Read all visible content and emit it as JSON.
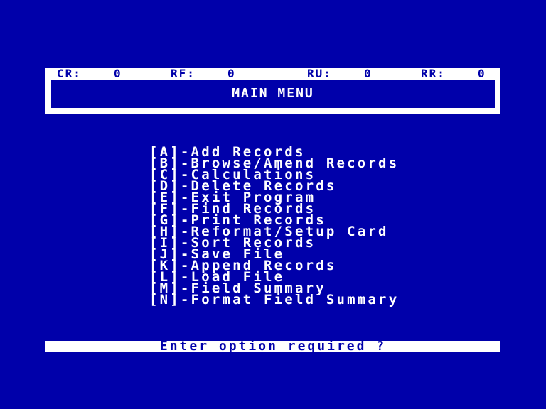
{
  "status": {
    "cr": {
      "label": "CR:",
      "value": "0"
    },
    "rf": {
      "label": "RF:",
      "value": "0"
    },
    "ru": {
      "label": "RU:",
      "value": "0"
    },
    "rr": {
      "label": "RR:",
      "value": "0"
    }
  },
  "title": "MAIN MENU",
  "menu": [
    "[A]-Add Records",
    "[B]-Browse/Amend Records",
    "[C]-Calculations",
    "[D]-Delete Records",
    "[E]-Exit Program",
    "[F]-Find Records",
    "[G]-Print Records",
    "[H]-Reformat/Setup Card",
    "[I]-Sort Records",
    "[J]-Save File",
    "[K]-Append Records",
    "[L]-Load File",
    "[M]-Field Summary",
    "[N]-Format Field Summary"
  ],
  "prompt": "Enter option required ?",
  "colors": {
    "background": "#0000aa",
    "foreground": "#ffffff"
  }
}
